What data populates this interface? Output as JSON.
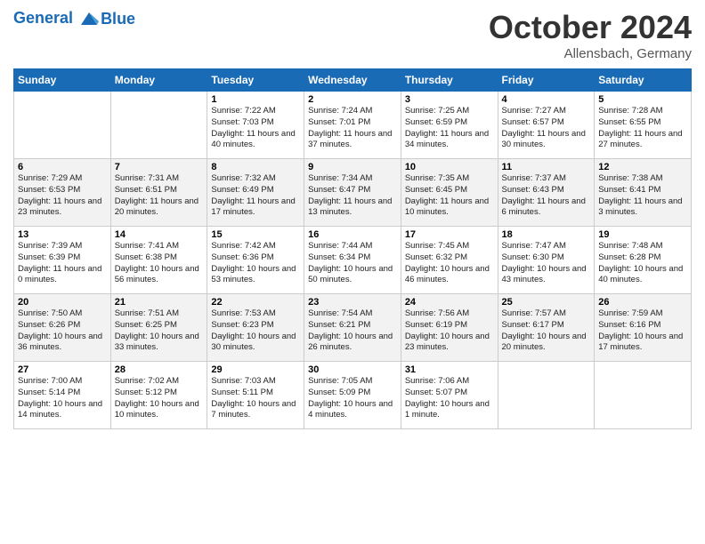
{
  "header": {
    "logo_line1": "General",
    "logo_line2": "Blue",
    "month": "October 2024",
    "location": "Allensbach, Germany"
  },
  "columns": [
    "Sunday",
    "Monday",
    "Tuesday",
    "Wednesday",
    "Thursday",
    "Friday",
    "Saturday"
  ],
  "weeks": [
    [
      {
        "num": "",
        "info": ""
      },
      {
        "num": "",
        "info": ""
      },
      {
        "num": "1",
        "info": "Sunrise: 7:22 AM\nSunset: 7:03 PM\nDaylight: 11 hours and 40 minutes."
      },
      {
        "num": "2",
        "info": "Sunrise: 7:24 AM\nSunset: 7:01 PM\nDaylight: 11 hours and 37 minutes."
      },
      {
        "num": "3",
        "info": "Sunrise: 7:25 AM\nSunset: 6:59 PM\nDaylight: 11 hours and 34 minutes."
      },
      {
        "num": "4",
        "info": "Sunrise: 7:27 AM\nSunset: 6:57 PM\nDaylight: 11 hours and 30 minutes."
      },
      {
        "num": "5",
        "info": "Sunrise: 7:28 AM\nSunset: 6:55 PM\nDaylight: 11 hours and 27 minutes."
      }
    ],
    [
      {
        "num": "6",
        "info": "Sunrise: 7:29 AM\nSunset: 6:53 PM\nDaylight: 11 hours and 23 minutes."
      },
      {
        "num": "7",
        "info": "Sunrise: 7:31 AM\nSunset: 6:51 PM\nDaylight: 11 hours and 20 minutes."
      },
      {
        "num": "8",
        "info": "Sunrise: 7:32 AM\nSunset: 6:49 PM\nDaylight: 11 hours and 17 minutes."
      },
      {
        "num": "9",
        "info": "Sunrise: 7:34 AM\nSunset: 6:47 PM\nDaylight: 11 hours and 13 minutes."
      },
      {
        "num": "10",
        "info": "Sunrise: 7:35 AM\nSunset: 6:45 PM\nDaylight: 11 hours and 10 minutes."
      },
      {
        "num": "11",
        "info": "Sunrise: 7:37 AM\nSunset: 6:43 PM\nDaylight: 11 hours and 6 minutes."
      },
      {
        "num": "12",
        "info": "Sunrise: 7:38 AM\nSunset: 6:41 PM\nDaylight: 11 hours and 3 minutes."
      }
    ],
    [
      {
        "num": "13",
        "info": "Sunrise: 7:39 AM\nSunset: 6:39 PM\nDaylight: 11 hours and 0 minutes."
      },
      {
        "num": "14",
        "info": "Sunrise: 7:41 AM\nSunset: 6:38 PM\nDaylight: 10 hours and 56 minutes."
      },
      {
        "num": "15",
        "info": "Sunrise: 7:42 AM\nSunset: 6:36 PM\nDaylight: 10 hours and 53 minutes."
      },
      {
        "num": "16",
        "info": "Sunrise: 7:44 AM\nSunset: 6:34 PM\nDaylight: 10 hours and 50 minutes."
      },
      {
        "num": "17",
        "info": "Sunrise: 7:45 AM\nSunset: 6:32 PM\nDaylight: 10 hours and 46 minutes."
      },
      {
        "num": "18",
        "info": "Sunrise: 7:47 AM\nSunset: 6:30 PM\nDaylight: 10 hours and 43 minutes."
      },
      {
        "num": "19",
        "info": "Sunrise: 7:48 AM\nSunset: 6:28 PM\nDaylight: 10 hours and 40 minutes."
      }
    ],
    [
      {
        "num": "20",
        "info": "Sunrise: 7:50 AM\nSunset: 6:26 PM\nDaylight: 10 hours and 36 minutes."
      },
      {
        "num": "21",
        "info": "Sunrise: 7:51 AM\nSunset: 6:25 PM\nDaylight: 10 hours and 33 minutes."
      },
      {
        "num": "22",
        "info": "Sunrise: 7:53 AM\nSunset: 6:23 PM\nDaylight: 10 hours and 30 minutes."
      },
      {
        "num": "23",
        "info": "Sunrise: 7:54 AM\nSunset: 6:21 PM\nDaylight: 10 hours and 26 minutes."
      },
      {
        "num": "24",
        "info": "Sunrise: 7:56 AM\nSunset: 6:19 PM\nDaylight: 10 hours and 23 minutes."
      },
      {
        "num": "25",
        "info": "Sunrise: 7:57 AM\nSunset: 6:17 PM\nDaylight: 10 hours and 20 minutes."
      },
      {
        "num": "26",
        "info": "Sunrise: 7:59 AM\nSunset: 6:16 PM\nDaylight: 10 hours and 17 minutes."
      }
    ],
    [
      {
        "num": "27",
        "info": "Sunrise: 7:00 AM\nSunset: 5:14 PM\nDaylight: 10 hours and 14 minutes."
      },
      {
        "num": "28",
        "info": "Sunrise: 7:02 AM\nSunset: 5:12 PM\nDaylight: 10 hours and 10 minutes."
      },
      {
        "num": "29",
        "info": "Sunrise: 7:03 AM\nSunset: 5:11 PM\nDaylight: 10 hours and 7 minutes."
      },
      {
        "num": "30",
        "info": "Sunrise: 7:05 AM\nSunset: 5:09 PM\nDaylight: 10 hours and 4 minutes."
      },
      {
        "num": "31",
        "info": "Sunrise: 7:06 AM\nSunset: 5:07 PM\nDaylight: 10 hours and 1 minute."
      },
      {
        "num": "",
        "info": ""
      },
      {
        "num": "",
        "info": ""
      }
    ]
  ]
}
